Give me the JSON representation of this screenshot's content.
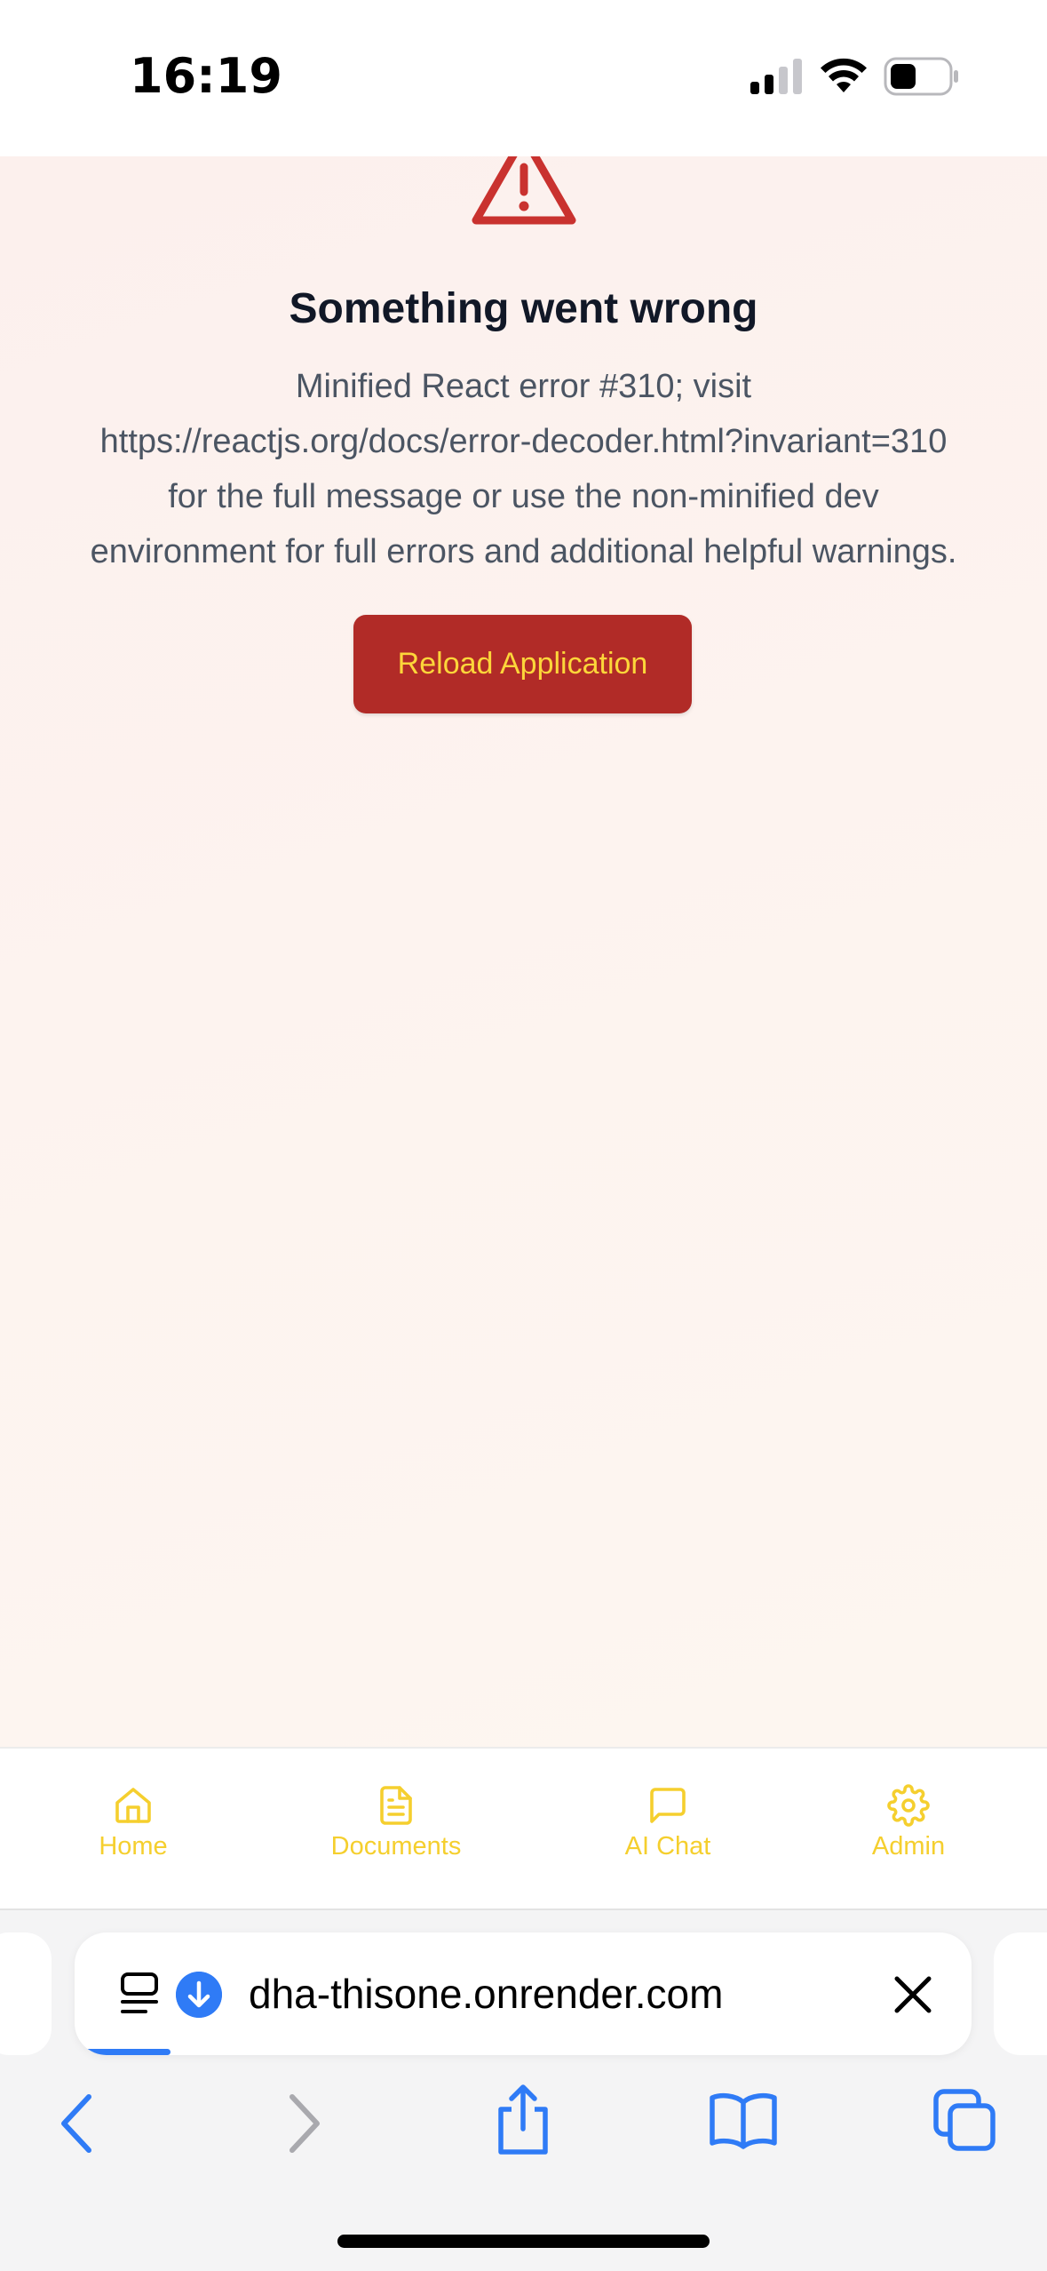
{
  "status_bar": {
    "time": "16:19",
    "signal_icon": "cellular-signal-icon",
    "wifi_icon": "wifi-icon",
    "battery_icon": "battery-icon"
  },
  "error": {
    "icon": "warning-triangle-icon",
    "title": "Something went wrong",
    "message_lines": [
      "Minified React error #310; visit",
      "https://reactjs.org/docs/error-decoder.html?invariant=310",
      "for the full message or use the non-minified dev",
      "environment for full errors and additional helpful warnings."
    ],
    "reload_label": "Reload Application"
  },
  "bottom_nav": {
    "items": [
      {
        "label": "Home",
        "icon": "home-icon"
      },
      {
        "label": "Documents",
        "icon": "document-icon"
      },
      {
        "label": "AI Chat",
        "icon": "chat-bubble-icon"
      },
      {
        "label": "Admin",
        "icon": "gear-icon"
      }
    ],
    "accent_color": "#f5cf2e"
  },
  "browser": {
    "url": "dha-thisone.onrender.com",
    "accent_color": "#2f7bf6",
    "toolbar": [
      "back-icon",
      "forward-icon",
      "share-icon",
      "bookmarks-icon",
      "tabs-icon"
    ]
  },
  "colors": {
    "error_red": "#b12b27",
    "reload_text": "#fcd63a"
  }
}
